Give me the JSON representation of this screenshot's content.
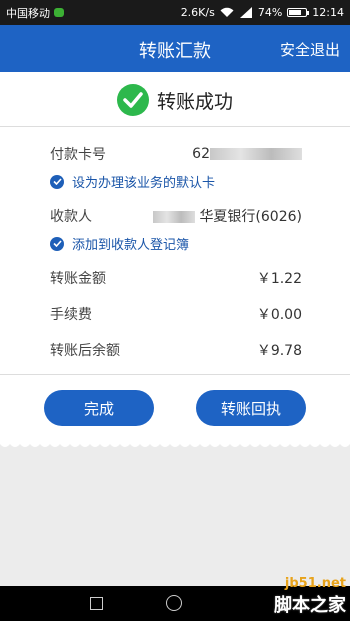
{
  "statusbar": {
    "carrier": "中国移动",
    "speed": "2.6K/s",
    "battery": "74%",
    "battery_level": 0.74,
    "time": "12:14",
    "network": "4G"
  },
  "header": {
    "title": "转账汇款",
    "logout": "安全退出"
  },
  "success": {
    "text": "转账成功"
  },
  "payer": {
    "label": "付款卡号",
    "card_prefix": "62",
    "default_option": "设为办理该业务的默认卡"
  },
  "payee": {
    "label": "收款人",
    "bank": "华夏银行(6026)",
    "register_option": "添加到收款人登记簿"
  },
  "amounts": [
    {
      "label": "转账金额",
      "value": "￥1.22"
    },
    {
      "label": "手续费",
      "value": "￥0.00"
    },
    {
      "label": "转账后余额",
      "value": "￥9.78"
    }
  ],
  "buttons": {
    "done": "完成",
    "receipt": "转账回执"
  },
  "watermark": {
    "url": "jb51.net",
    "text": "脚本之家"
  },
  "colors": {
    "primary": "#1e63c4",
    "success": "#2db84c"
  }
}
